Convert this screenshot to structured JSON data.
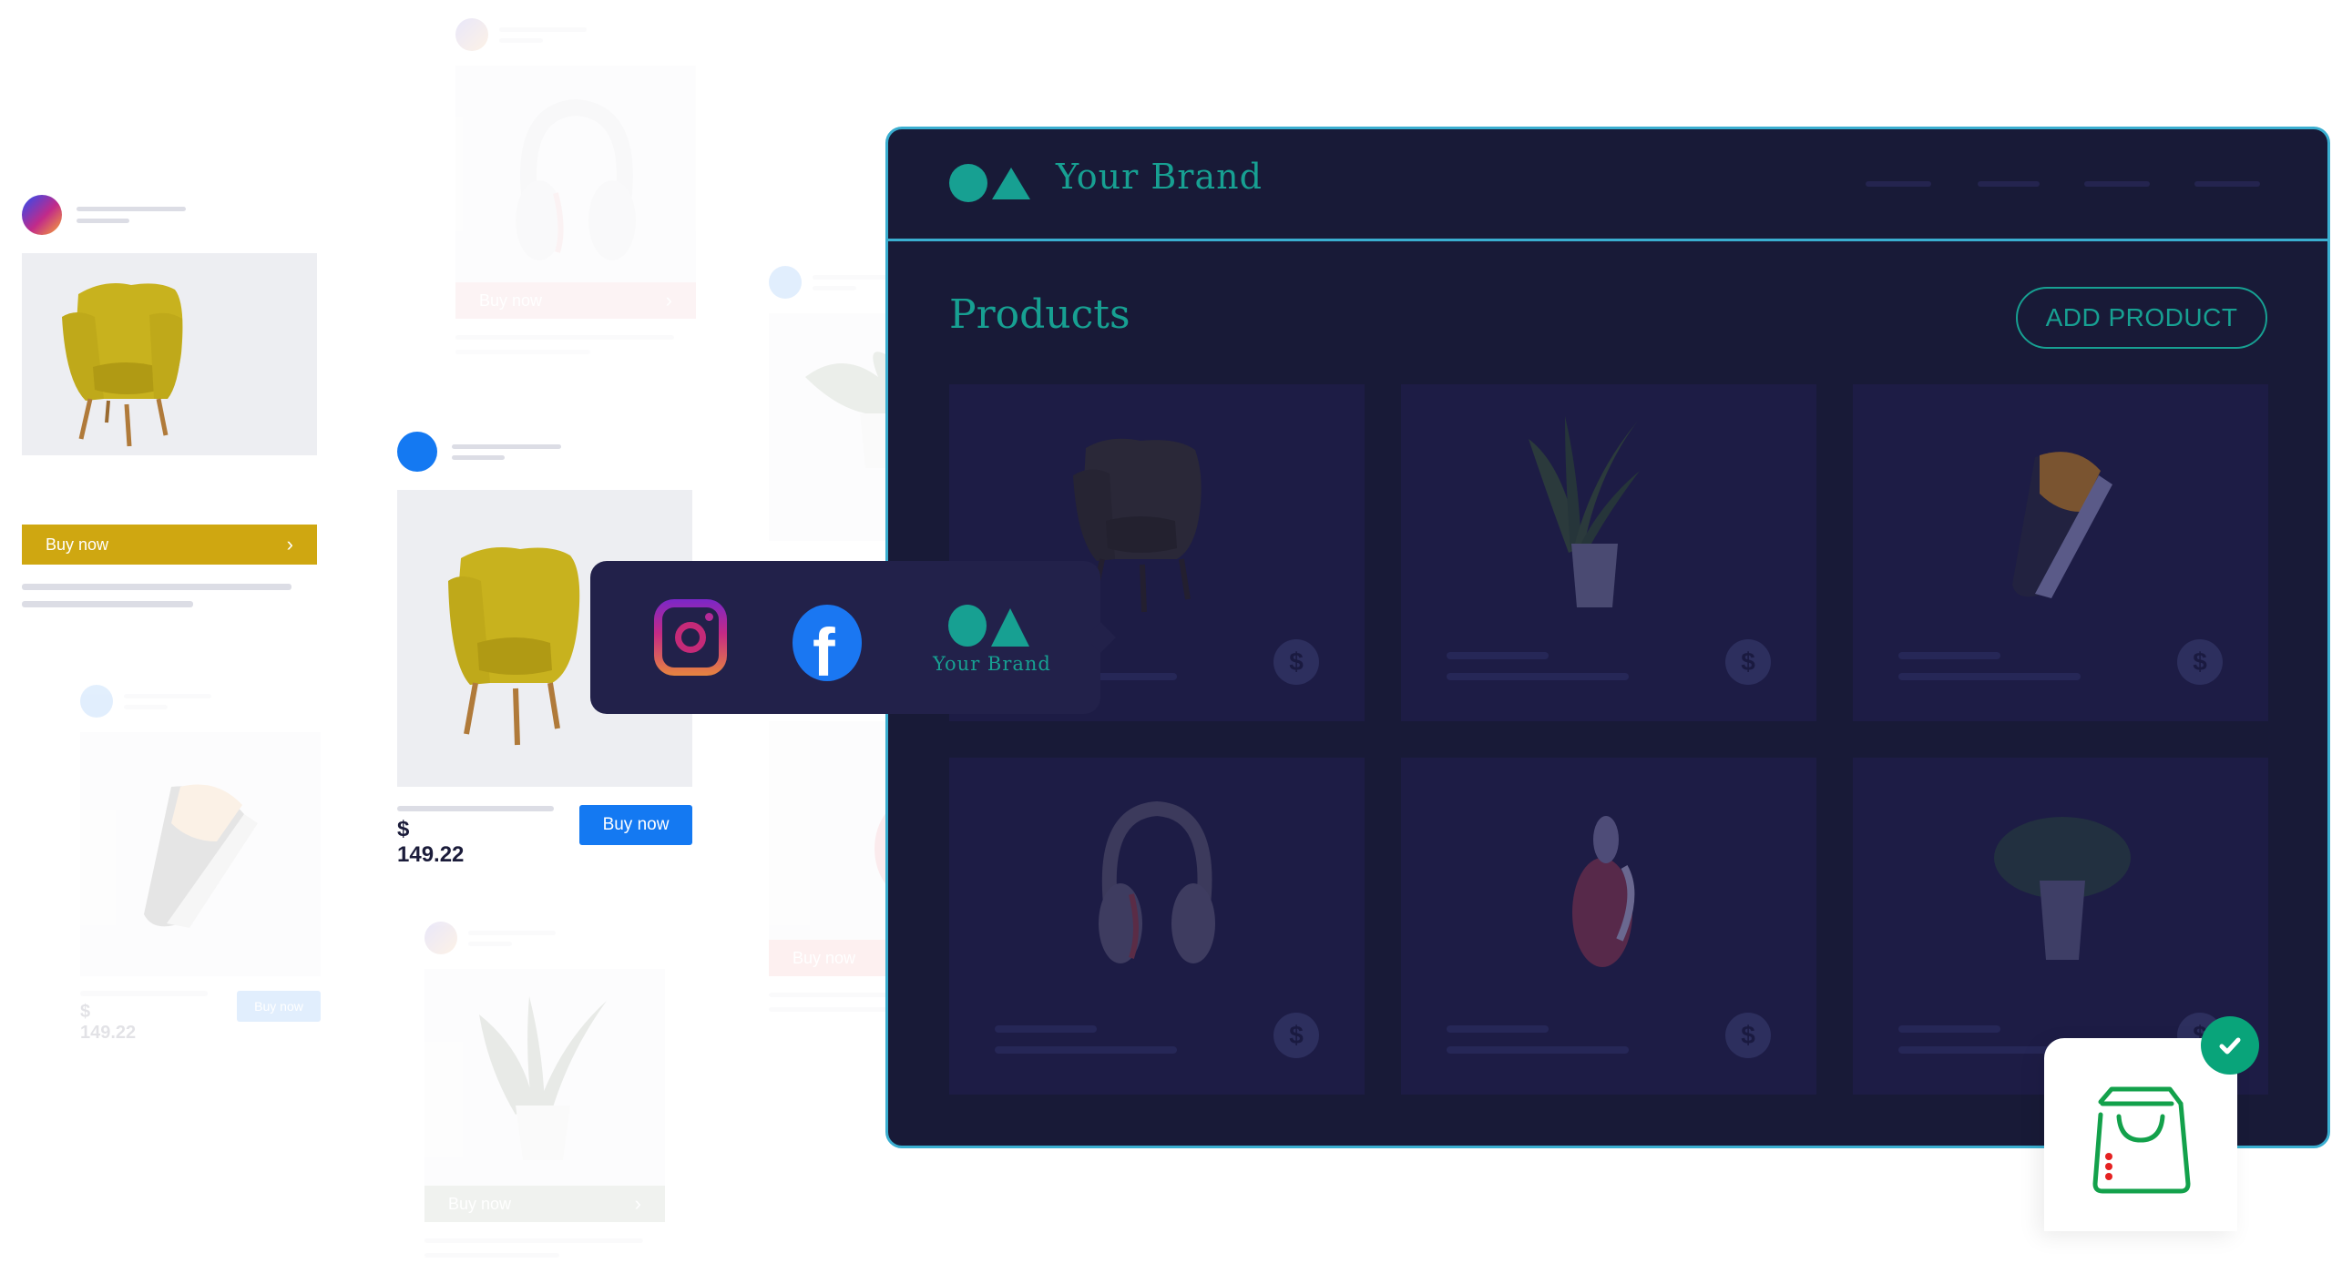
{
  "feed_cards": [
    {
      "id": "instagram-card",
      "network": "instagram",
      "product": "yellow armchair",
      "button_label": "Buy now",
      "button_color": "#cfa711",
      "chevron": "›"
    },
    {
      "id": "facebook-card",
      "network": "facebook",
      "product": "yellow armchair",
      "price": "$ 149.22",
      "button_label": "Buy now",
      "button_color": "#1479f2"
    },
    {
      "id": "faint-headphones-card",
      "product": "headphones",
      "button_label": "Buy now",
      "chevron": "›"
    },
    {
      "id": "faint-shoe-card",
      "product": "sneaker",
      "price": "$ 149.22",
      "button_label": "Buy now"
    },
    {
      "id": "faint-plant-card",
      "product": "snake plant",
      "button_label": "Buy now",
      "chevron": "›"
    },
    {
      "id": "faint-plant2-card",
      "product": "potted plant"
    },
    {
      "id": "faint-perfume-card",
      "product": "perfume",
      "button_label": "Buy now"
    }
  ],
  "dashboard": {
    "brand_name": "Your Brand",
    "page_title": "Products",
    "add_product_label": "ADD PRODUCT",
    "nav_items_count": 4,
    "products": [
      {
        "name": "armchair",
        "price_icon": "$"
      },
      {
        "name": "snake plant",
        "price_icon": "$"
      },
      {
        "name": "sneaker",
        "price_icon": "$"
      },
      {
        "name": "headphones",
        "price_icon": "$"
      },
      {
        "name": "perfume",
        "price_icon": "$"
      },
      {
        "name": "potted plant",
        "price_icon": "$"
      }
    ]
  },
  "channel_popup": {
    "channels": [
      "instagram-icon",
      "facebook-icon",
      "your-brand-logo"
    ],
    "facebook_glyph": "f",
    "brand_name": "Your Brand"
  },
  "shop_badge": {
    "icon": "shopping-bag-icon",
    "status": "connected"
  },
  "colors": {
    "accent_teal": "#17a092",
    "panel_bg": "#181a37",
    "panel_border": "#3aaed0",
    "card_bg": "#1d1c45",
    "facebook_blue": "#1a77f2",
    "buy_yellow": "#cfa711",
    "check_green": "#09a47a"
  }
}
